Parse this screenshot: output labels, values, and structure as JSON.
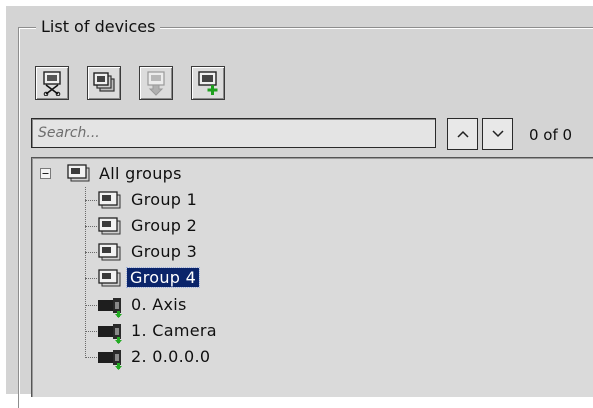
{
  "groupbox": {
    "title": "List of devices"
  },
  "toolbar": {
    "buttons": [
      {
        "icon": "disconnect-devices-icon"
      },
      {
        "icon": "copy-devices-icon"
      },
      {
        "icon": "move-down-icon"
      },
      {
        "icon": "add-device-icon"
      }
    ]
  },
  "search": {
    "placeholder": "Search...",
    "value": "",
    "result_count": "0 of 0"
  },
  "tree": {
    "root": {
      "label": "All groups",
      "expanded": true
    },
    "groups": [
      {
        "label": "Group 1"
      },
      {
        "label": "Group 2"
      },
      {
        "label": "Group 3"
      },
      {
        "label": "Group 4",
        "selected": true
      }
    ],
    "cameras": [
      {
        "label": "0. Axis"
      },
      {
        "label": "1. Camera"
      },
      {
        "label": "2. 0.0.0.0"
      }
    ]
  },
  "colors": {
    "selection": "#0a246a",
    "panel": "#d4d4d4",
    "tree_bg": "#dadada"
  }
}
